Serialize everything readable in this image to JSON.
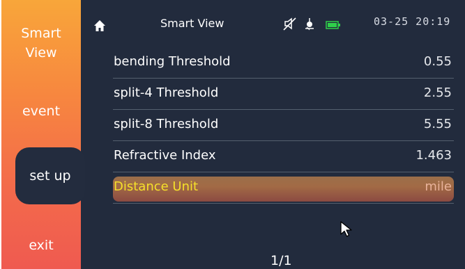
{
  "status_bar": {
    "title": "Smart View",
    "clock": "03-25 20:19",
    "icons": [
      "home-icon",
      "mute-icon",
      "gps-icon",
      "battery-icon"
    ]
  },
  "sidebar": {
    "items": [
      {
        "label_line1": "Smart",
        "label_line2": "View"
      },
      {
        "label_line1": "event"
      },
      {
        "label_line1": "set up",
        "active": true
      },
      {
        "label_line1": "exit"
      }
    ]
  },
  "settings": {
    "rows": [
      {
        "label": "bending Threshold",
        "value": "0.55"
      },
      {
        "label": "split-4 Threshold",
        "value": "2.55"
      },
      {
        "label": "split-8 Threshold",
        "value": "5.55"
      },
      {
        "label": "Refractive Index",
        "value": "1.463"
      },
      {
        "label": "Distance Unit",
        "value": "mile",
        "selected": true
      }
    ]
  },
  "pagination": {
    "text": "1/1"
  },
  "colors": {
    "background": "#222b3d",
    "sidebar_top": "#f8a63a",
    "sidebar_bottom": "#ef5a50",
    "highlight_text": "#f5e02a",
    "battery": "#2fd04a"
  }
}
